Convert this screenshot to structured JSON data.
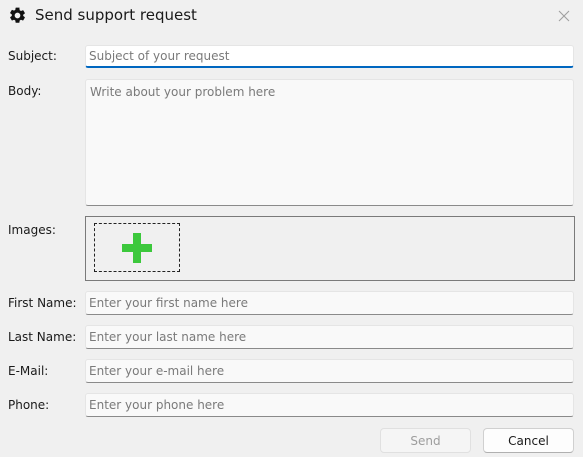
{
  "window": {
    "title": "Send support request",
    "title_icon": "gear-icon",
    "close_icon": "close-icon"
  },
  "form": {
    "subject": {
      "label": "Subject:",
      "placeholder": "Subject of your request",
      "value": ""
    },
    "body": {
      "label": "Body:",
      "placeholder": "Write about your problem here",
      "value": ""
    },
    "images": {
      "label": "Images:",
      "add_icon": "plus-icon"
    },
    "first_name": {
      "label": "First Name:",
      "placeholder": "Enter your first name here",
      "value": ""
    },
    "last_name": {
      "label": "Last Name:",
      "placeholder": "Enter your last name here",
      "value": ""
    },
    "email": {
      "label": "E-Mail:",
      "placeholder": "Enter your e-mail here",
      "value": ""
    },
    "phone": {
      "label": "Phone:",
      "placeholder": "Enter your phone here",
      "value": ""
    }
  },
  "buttons": {
    "send": "Send",
    "cancel": "Cancel"
  },
  "colors": {
    "accent": "#0067c0",
    "plus": "#3cc83c"
  }
}
